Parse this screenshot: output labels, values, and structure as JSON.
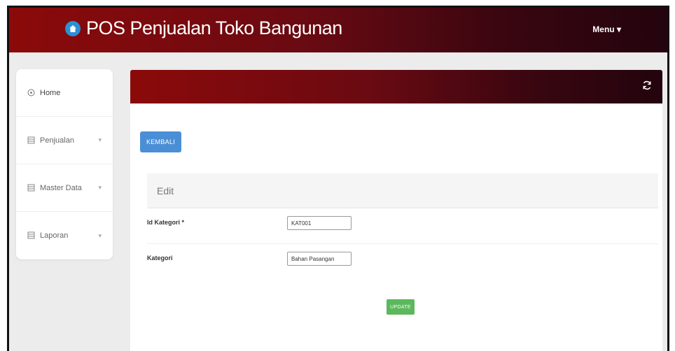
{
  "navbar": {
    "title": "POS Penjualan Toko Bangunan",
    "menu_label": "Menu",
    "menu_caret": "▾",
    "brand_icon": "app-logo-icon",
    "gradient_colors": [
      "#8b0a0a",
      "#23040e"
    ]
  },
  "sidebar": {
    "items": [
      {
        "label": "Home",
        "icon": "home-icon",
        "has_caret": false
      },
      {
        "label": "Penjualan",
        "icon": "list-icon",
        "has_caret": true
      },
      {
        "label": "Master Data",
        "icon": "list-icon",
        "has_caret": true
      },
      {
        "label": "Laporan",
        "icon": "list-icon",
        "has_caret": true
      }
    ]
  },
  "content": {
    "header_icon": "refresh-icon",
    "back_button": "KEMBALI",
    "panel": {
      "heading": "Edit",
      "fields": [
        {
          "label": "Id Kategori *",
          "value": "KAT001"
        },
        {
          "label": "Kategori",
          "value": "Bahan Pasangan"
        }
      ],
      "submit_label": "UPDATE"
    }
  },
  "colors": {
    "primary_button": "#4a8fd6",
    "success_button": "#5cb85c",
    "brand_icon": "#2d8fd6"
  }
}
